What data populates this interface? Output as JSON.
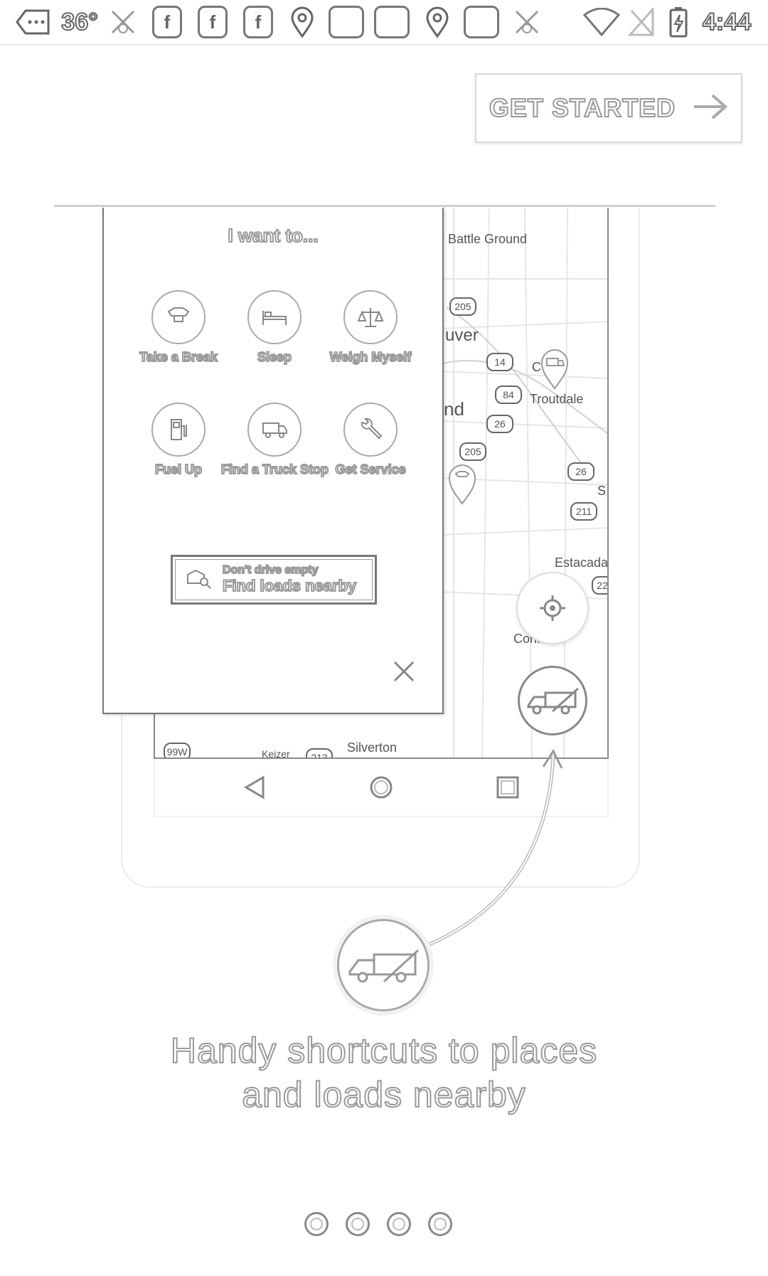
{
  "status_bar": {
    "temperature": "36°",
    "time": "4:44",
    "icons": [
      "more-icon",
      "peace-icon",
      "facebook-icon",
      "facebook-icon",
      "facebook-icon",
      "location-icon",
      "blank-app-icon",
      "blank-app-icon",
      "location-icon",
      "blank-app-icon",
      "peace-icon",
      "wifi-icon",
      "no-sim-icon",
      "battery-charging-icon"
    ]
  },
  "header": {
    "get_started_label": "GET STARTED",
    "arrow_icon": "arrow-right-icon"
  },
  "menu": {
    "title": "I want to...",
    "items": [
      {
        "label": "Take a Break",
        "icon": "shirt-icon"
      },
      {
        "label": "Sleep",
        "icon": "bed-icon"
      },
      {
        "label": "Weigh Myself",
        "icon": "scale-icon"
      },
      {
        "label": "Fuel Up",
        "icon": "fuel-pump-icon"
      },
      {
        "label": "Find a Truck Stop",
        "icon": "truck-icon"
      },
      {
        "label": "Get Service",
        "icon": "wrench-icon"
      }
    ],
    "loads": {
      "line1": "Don't drive empty",
      "line2": "Find loads nearby",
      "icon": "truck-search-icon"
    },
    "close_icon": "close-icon"
  },
  "map": {
    "labels": [
      "Battle Ground",
      "uver",
      "Troutdale",
      "nd",
      "Estacada",
      "S.",
      "Con...",
      "Silverton",
      "C",
      "Keizer"
    ],
    "shields": [
      "205",
      "14",
      "84",
      "26",
      "205",
      "26",
      "211",
      "22",
      "99W",
      "213"
    ]
  },
  "caption": {
    "line1": "Handy shortcuts to places",
    "line2": "and loads nearby"
  },
  "pagination": {
    "total": 4,
    "current": 1
  }
}
